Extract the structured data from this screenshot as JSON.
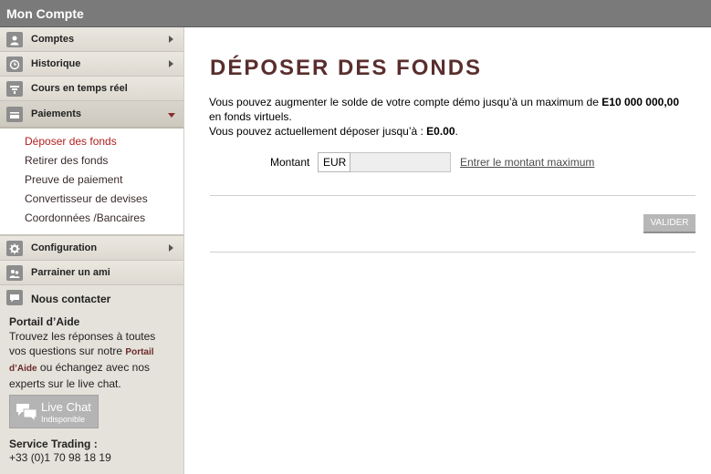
{
  "window": {
    "title": "Mon Compte"
  },
  "sidebar": {
    "items": [
      {
        "label": "Comptes",
        "icon": "user-icon"
      },
      {
        "label": "Historique",
        "icon": "history-icon"
      },
      {
        "label": "Cours en temps réel",
        "icon": "filter-icon"
      },
      {
        "label": "Paiements",
        "icon": "card-icon",
        "expanded": true
      }
    ],
    "payments_submenu": [
      {
        "label": "Déposer des fonds",
        "current": true
      },
      {
        "label": "Retirer des fonds"
      },
      {
        "label": "Preuve de paiement"
      },
      {
        "label": "Convertisseur de devises"
      },
      {
        "label": "Coordonnées /Bancaires"
      }
    ],
    "items_after": [
      {
        "label": "Configuration",
        "icon": "gear-icon"
      },
      {
        "label": "Parrainer un ami",
        "icon": "users-icon"
      }
    ],
    "contact": {
      "label": "Nous contacter",
      "help_title": "Portail d’Aide",
      "help_text_1": "Trouvez les réponses à toutes vos questions sur notre",
      "help_link": "Portail d’Aide",
      "help_text_2": "ou échangez avec nos experts sur le live chat.",
      "livechat_title": "Live Chat",
      "livechat_status": "Indisponible",
      "service_label": "Service Trading :",
      "service_phone": "+33 (0)1 70 98 18 19"
    }
  },
  "main": {
    "title": "DÉPOSER DES FONDS",
    "intro_1": "Vous pouvez augmenter le solde de votre compte démo jusqu’à un maximum de",
    "intro_max": "E10 000 000,00",
    "intro_2": "en fonds virtuels.",
    "intro_3": "Vous pouvez actuellement déposer jusqu’à :",
    "intro_available": "E0.00",
    "intro_end": ".",
    "amount_label": "Montant",
    "currency": "EUR",
    "amount_value": "",
    "max_link": "Entrer le montant maximum",
    "validate_label": "VALIDER"
  },
  "colors": {
    "titlebar": "#7a7a7a",
    "sidebar_bg": "#e5e2db",
    "accent_title": "#5a2e2e",
    "current_link": "#b21f1f",
    "button": "#b7b7b7"
  }
}
